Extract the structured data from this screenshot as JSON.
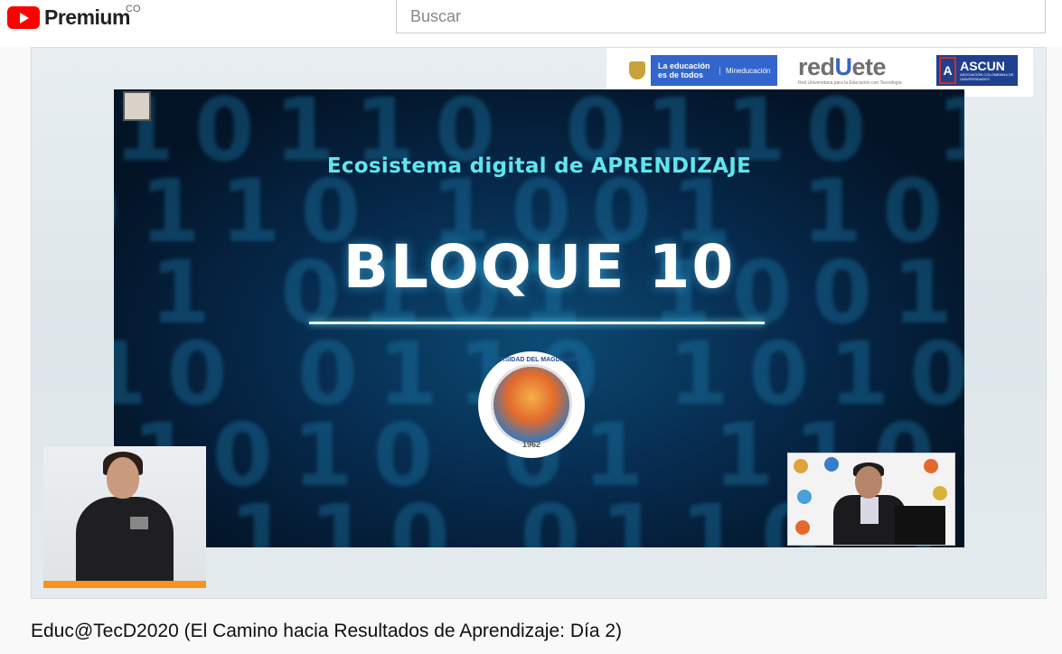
{
  "header": {
    "brand": "Premium",
    "country": "CO",
    "search_placeholder": "Buscar"
  },
  "sponsors": {
    "ministry_line": "La educación es de todos",
    "ministry_name": "Mineducación",
    "renata_title_a": "red",
    "renata_title_b": "U",
    "renata_title_c": "ete",
    "renata_subtitle": "Red Universitaria para la Educación con Tecnología",
    "ascun_name": "ASCUN",
    "ascun_subtitle": "ASOCIACIÓN COLOMBIANA DE UNIVERSIDADES"
  },
  "slide": {
    "subtitle": "Ecosistema digital de APRENDIZAJE",
    "title": "BLOQUE 10",
    "seal_text": "UNIVERSIDAD DEL MAGDALENA",
    "seal_year": "1962",
    "background_digits": [
      "10110  0110  1",
      "0110  1001  10",
      "1  0101  1001",
      "10  0110  1010",
      "1010  01  1101"
    ]
  },
  "video": {
    "title": "Educ@TecD2020 (El Camino hacia Resultados de Aprendizaje: Día 2)"
  },
  "colors": {
    "brand_red": "#ff0000",
    "slide_cyan": "#5fe6ec",
    "accent_orange": "#f7941d"
  }
}
